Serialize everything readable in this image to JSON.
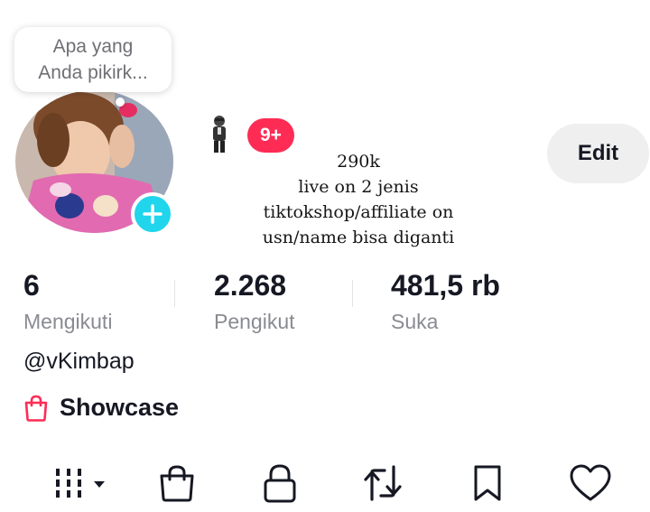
{
  "bubble": {
    "text": "Apa yang\nAnda pikirk..."
  },
  "notifications": {
    "badge": "9+"
  },
  "caption": {
    "lines": [
      "290k",
      "live on 2 jenis",
      "tiktokshop/affiliate on",
      "usn/name bisa diganti"
    ]
  },
  "edit_label": "Edit",
  "stats": [
    {
      "value": "6",
      "label": "Mengikuti"
    },
    {
      "value": "2.268",
      "label": "Pengikut"
    },
    {
      "value": "481,5 rb",
      "label": "Suka"
    }
  ],
  "username": "@vKimbap",
  "showcase": {
    "label": "Showcase"
  },
  "tabs": [
    "videos-grid-icon",
    "shop-bag-icon",
    "lock-icon",
    "repost-icon",
    "bookmark-icon",
    "heart-icon"
  ],
  "colors": {
    "accent": "#fe2c55",
    "plus": "#20d5ec",
    "muted": "#8a8b91"
  }
}
